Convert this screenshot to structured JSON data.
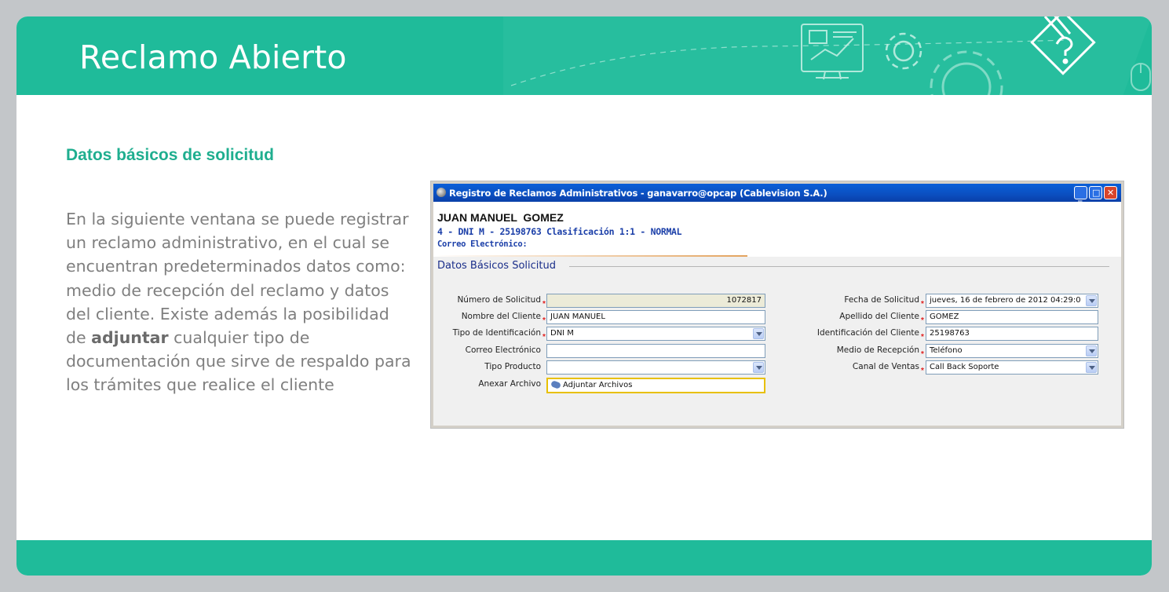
{
  "slide": {
    "title": "Reclamo Abierto",
    "section_title": "Datos básicos de solicitud",
    "description_before": "En la siguiente ventana se puede registrar un reclamo administrativo, en el cual se encuentran predeterminados datos como: medio de recepción del reclamo y datos del cliente. Existe además la posibilidad de ",
    "description_bold": "adjuntar",
    "description_after": " cualquier tipo de documentación que sirve de respaldo para los trámites que realice el cliente"
  },
  "window": {
    "title": "Registro de Reclamos Administrativos - ganavarro@opcap (Cablevision S.A.)",
    "minimize_icon": "minimize-icon",
    "maximize_icon": "maximize-icon",
    "close_icon": "close-icon"
  },
  "client": {
    "name": "JUAN MANUEL  GOMEZ",
    "id_line": "4 - DNI M - 25198763 Clasificación 1:1 - NORMAL",
    "email_line": "Correo Electrónico:"
  },
  "form": {
    "group_title": "Datos Básicos Solicitud",
    "left": [
      {
        "label": "Número de Solicitud",
        "value": "1072817",
        "required": true,
        "type": "readonly"
      },
      {
        "label": "Nombre del Cliente",
        "value": "JUAN MANUEL",
        "required": true,
        "type": "text"
      },
      {
        "label": "Tipo de Identificación",
        "value": "DNI M",
        "required": true,
        "type": "select"
      },
      {
        "label": "Correo Electrónico",
        "value": "",
        "required": false,
        "type": "text"
      },
      {
        "label": "Tipo Producto",
        "value": "",
        "required": false,
        "type": "select"
      },
      {
        "label": "Anexar Archivo",
        "value": "Adjuntar Archivos",
        "required": false,
        "type": "button"
      }
    ],
    "right": [
      {
        "label": "Fecha de Solicitud",
        "value": "jueves, 16 de febrero de 2012 04:29:0",
        "required": true,
        "type": "select"
      },
      {
        "label": "Apellido del Cliente",
        "value": "GOMEZ",
        "required": true,
        "type": "text"
      },
      {
        "label": "Identificación del Cliente",
        "value": "25198763",
        "required": true,
        "type": "text"
      },
      {
        "label": "Medio de Recepción",
        "value": "Teléfono",
        "required": true,
        "type": "select"
      },
      {
        "label": "Canal de Ventas",
        "value": "Call Back Soporte",
        "required": true,
        "type": "select"
      }
    ]
  },
  "colors": {
    "accent": "#1fbb9a",
    "section_title": "#1fae8f",
    "body_text": "#7f7f7f",
    "page_background": "#c3c6c9"
  }
}
